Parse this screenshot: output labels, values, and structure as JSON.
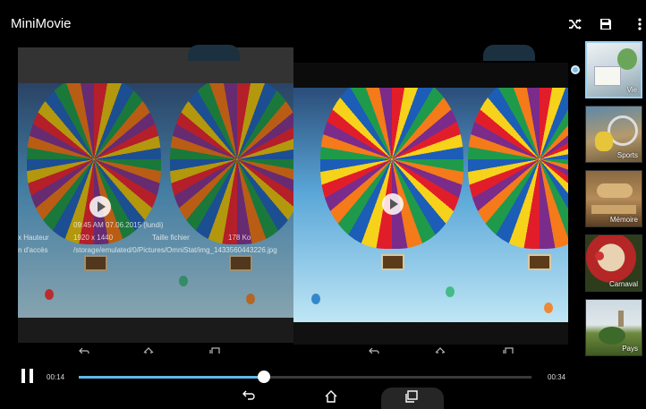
{
  "app_bar": {
    "title": "MiniMovie",
    "icons": [
      "shuffle-icon",
      "save-icon",
      "more-vert-icon"
    ]
  },
  "preview": {
    "left_panel_info": {
      "date": "09:45 AM 07.06.2015 (lundi)",
      "resolution_label": "x Hauteur",
      "resolution_value": "1920 x 1440",
      "size_label": "Taille fichier",
      "size_value": "178 Ko",
      "path_label": "n d'accès",
      "path_value": "/storage/emulated/0/Pictures/OmniStat/img_1433560443226.jpg"
    }
  },
  "themes": [
    {
      "label": "Vie",
      "selected": true
    },
    {
      "label": "Sports",
      "selected": false
    },
    {
      "label": "Mémoire",
      "selected": false
    },
    {
      "label": "Carnaval",
      "selected": false
    },
    {
      "label": "Pays",
      "selected": false
    }
  ],
  "playback": {
    "current_time": "00:14",
    "total_time": "00:34",
    "progress": 0.41,
    "state": "playing"
  },
  "colors": {
    "accent": "#5fb7e8",
    "background": "#000000"
  },
  "nav": {
    "icons": [
      "back-icon",
      "home-icon",
      "recent-apps-icon"
    ]
  }
}
